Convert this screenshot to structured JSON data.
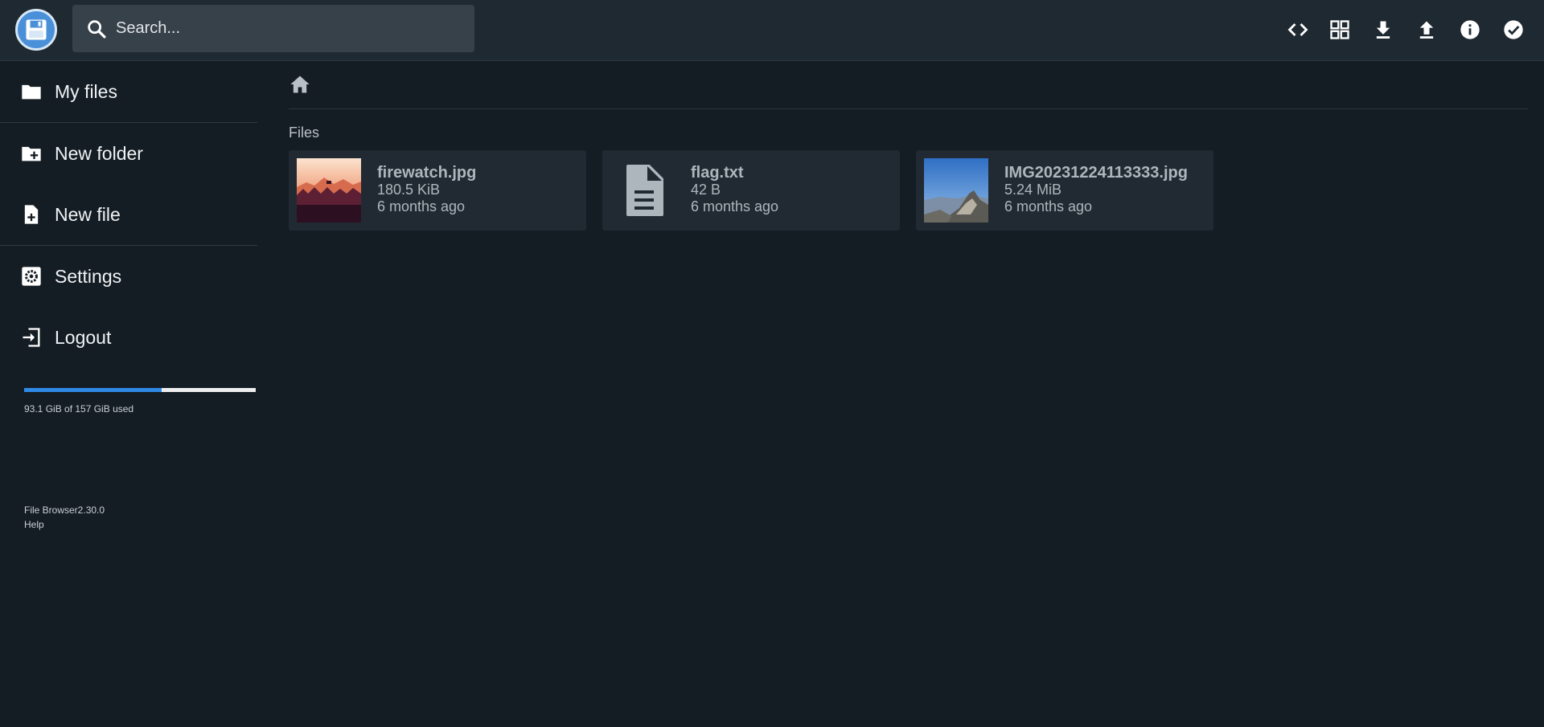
{
  "header": {
    "search_placeholder": "Search...",
    "actions": [
      {
        "icon": "code-icon"
      },
      {
        "icon": "grid-view-icon"
      },
      {
        "icon": "download-icon"
      },
      {
        "icon": "upload-icon"
      },
      {
        "icon": "info-icon"
      },
      {
        "icon": "check-circle-icon"
      }
    ]
  },
  "sidebar": {
    "items": [
      {
        "label": "My files",
        "icon": "folder-icon"
      },
      {
        "label": "New folder",
        "icon": "folder-plus-icon"
      },
      {
        "label": "New file",
        "icon": "file-plus-icon"
      },
      {
        "label": "Settings",
        "icon": "settings-icon"
      },
      {
        "label": "Logout",
        "icon": "logout-icon"
      }
    ],
    "usage": {
      "text": "93.1 GiB of 157 GiB used",
      "fraction": 0.593
    },
    "credits": {
      "app": "File Browser2.30.0",
      "help": "Help"
    }
  },
  "main": {
    "breadcrumb_icon": "home-icon",
    "section_title": "Files",
    "files": [
      {
        "name": "firewatch.jpg",
        "size": "180.5 KiB",
        "modified": "6 months ago",
        "icon": "image-thumbnail"
      },
      {
        "name": "flag.txt",
        "size": "42 B",
        "modified": "6 months ago",
        "icon": "document-icon"
      },
      {
        "name": "IMG20231224113333.jpg",
        "size": "5.24 MiB",
        "modified": "6 months ago",
        "icon": "image-thumbnail"
      }
    ]
  },
  "colors": {
    "background": "#141d24",
    "header": "#1f2931",
    "card": "#212a32",
    "accent": "#2f8ae6"
  }
}
